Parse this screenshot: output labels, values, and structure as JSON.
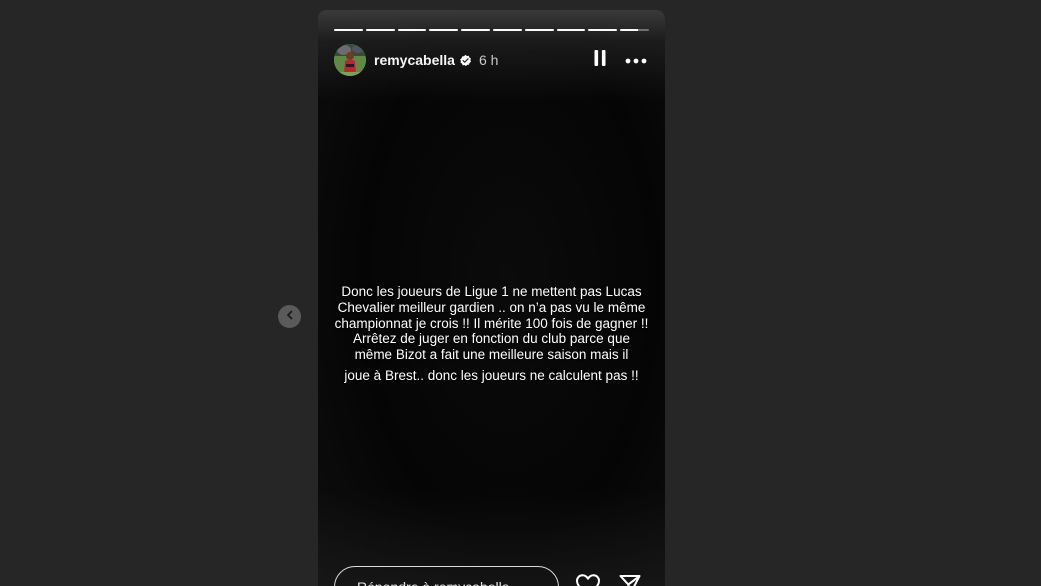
{
  "story": {
    "username": "remycabella",
    "verified": true,
    "time_ago": "6 h",
    "progress": {
      "segments_total": 10,
      "current_segment": 10,
      "current_progress": 0.62
    },
    "text_lines": [
      "Donc les joueurs de Ligue 1 ne mettent pas Lucas",
      "Chevalier meilleur gardien .. on n’a pas vu le même",
      "championnat je crois !! Il mérite 100 fois de gagner !!",
      "Arrêtez de juger en fonction du club parce que",
      "même Bizot a fait une meilleure saison mais il",
      "joue à Brest.. donc les joueurs ne calculent pas !!"
    ],
    "reply_placeholder": "Répondre à remycabella..."
  },
  "icons": {
    "pause": "pause-icon",
    "more": "more-options-icon",
    "verified": "verified-badge-icon",
    "like": "heart-icon",
    "share": "send-icon",
    "previous": "chevron-left-icon"
  },
  "colors": {
    "page_background": "#262626",
    "story_background": "#050505",
    "text": "#ffffff",
    "verified_badge": "#ffffff"
  }
}
